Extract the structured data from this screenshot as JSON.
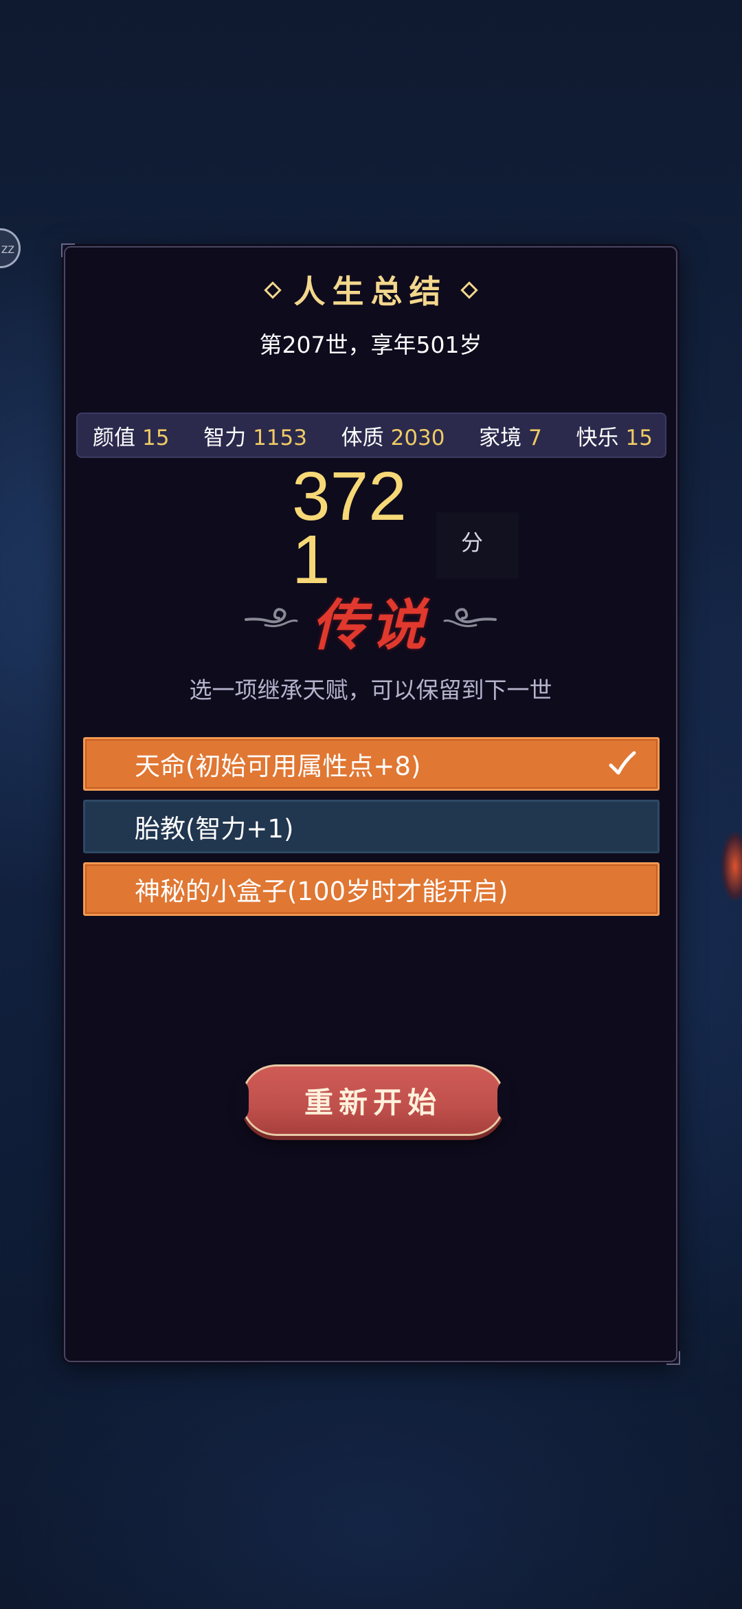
{
  "floating_ball": {
    "label": "ZZ"
  },
  "summary": {
    "title": "人生总结",
    "subtitle": "第207世，享年501岁",
    "stats": [
      {
        "name": "颜值",
        "value": "15"
      },
      {
        "name": "智力",
        "value": "1153"
      },
      {
        "name": "体质",
        "value": "2030"
      },
      {
        "name": "家境",
        "value": "7"
      },
      {
        "name": "快乐",
        "value": "15"
      }
    ],
    "score": "3721",
    "score_unit": "分",
    "rank": "传说",
    "hint": "选一项继承天赋，可以保留到下一世"
  },
  "talents": [
    {
      "label": "天命(初始可用属性点+8)",
      "selected": true,
      "color": "#e07733"
    },
    {
      "label": "胎教(智力+1)",
      "selected": false,
      "color": "#21364f"
    },
    {
      "label": "神秘的小盒子(100岁时才能开启)",
      "selected": false,
      "color": "#e07733"
    }
  ],
  "actions": {
    "restart_label": "重新开始"
  },
  "colors": {
    "accent_gold": "#f3d78d",
    "score_gold": "#f7d877",
    "rank_red": "#e1392e",
    "button_red": "#c0504c"
  }
}
